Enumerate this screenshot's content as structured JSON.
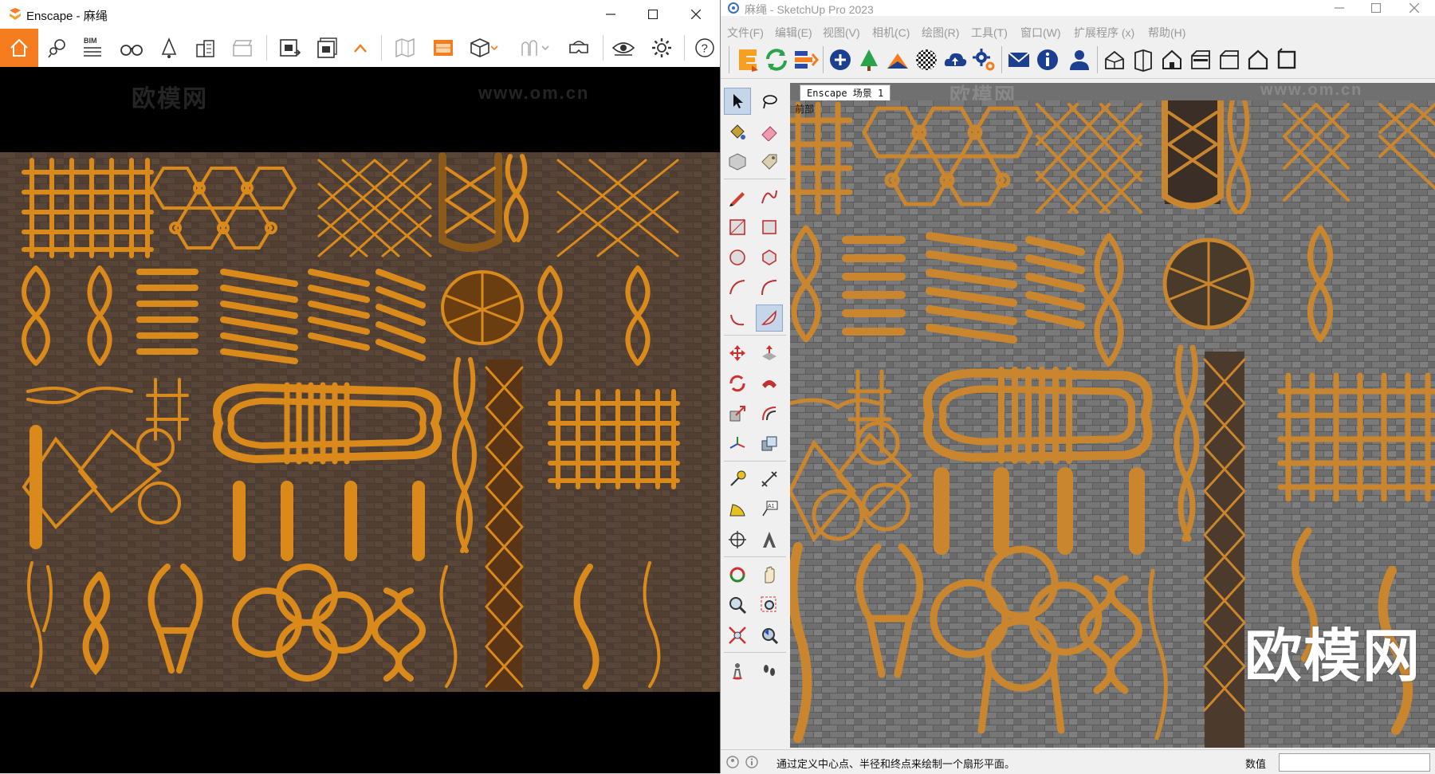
{
  "enscape": {
    "title": "Enscape - 麻绳",
    "toolbar": {
      "bim_label": "BIM",
      "tools": [
        "home-icon",
        "map-pin-icon",
        "bim-list-icon",
        "binoculars-icon",
        "bell-icon",
        "buildings-icon",
        "clapperboard-icon",
        "screenshot-icon",
        "batch-render-icon",
        "caret-up-icon",
        "map-icon",
        "panorama-icon",
        "cube-icon",
        "foot-icon",
        "vr-headset-icon",
        "eye-icon",
        "gear-icon",
        "help-icon"
      ]
    },
    "watermarks": [
      "欧模网",
      "www.om.cn"
    ]
  },
  "sketchup": {
    "title": "麻绳 - SketchUp Pro 2023",
    "menu": [
      "文件(F)",
      "编辑(E)",
      "视图(V)",
      "相机(C)",
      "绘图(R)",
      "工具(T)",
      "窗口(W)",
      "扩展程序 (x)",
      "帮助(H)"
    ],
    "scene_tab": "Enscape 场景 1",
    "view_label": "前部",
    "watermark_big": "欧模网",
    "watermarks": [
      "欧模网",
      "www.om.cn"
    ],
    "status_message": "通过定义中心点、半径和终点来绘制一个扇形平面。",
    "measurements_label": "数值",
    "measurements_value": ""
  },
  "colors": {
    "enscape_orange": "#f57c1f",
    "rope_enscape": "#d98a1a",
    "rope_sketchup": "#c9862e",
    "brick_enscape": "#4a3a30",
    "brick_sketchup": "#6e6e6e"
  }
}
